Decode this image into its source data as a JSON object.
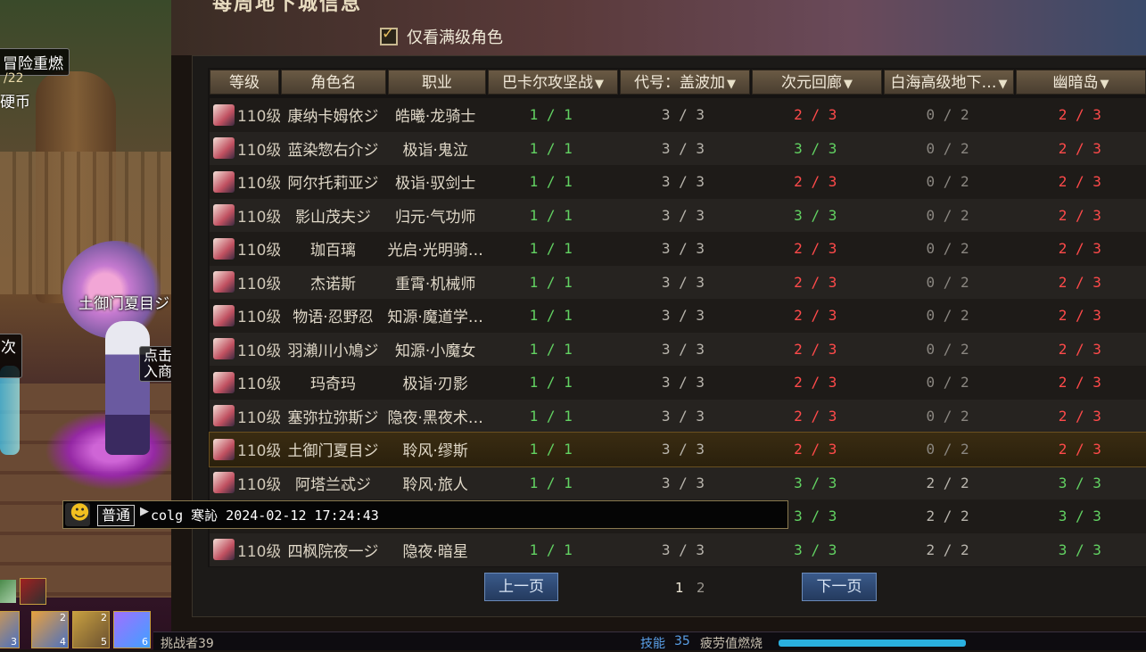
{
  "title": "每周地下城信息",
  "filter": {
    "label": "仅看满级角色",
    "checked": true
  },
  "columns": [
    {
      "label": "等级",
      "dropdown": false
    },
    {
      "label": "角色名",
      "dropdown": false
    },
    {
      "label": "职业",
      "dropdown": false
    },
    {
      "label": "巴卡尔攻坚战",
      "dropdown": true
    },
    {
      "label": "代号：盖波加",
      "dropdown": true
    },
    {
      "label": "次元回廊",
      "dropdown": true
    },
    {
      "label": "白海高级地下…",
      "dropdown": true
    },
    {
      "label": "幽暗岛",
      "dropdown": true
    }
  ],
  "rows": [
    {
      "level": "110级",
      "name": "康纳卡姆依ジ",
      "job": "皓曦·龙骑士",
      "s1": "1 / 1",
      "s2": "3 / 3",
      "s3": "2 / 3",
      "s4": "0 / 2",
      "s5": "2 / 3"
    },
    {
      "level": "110级",
      "name": "蓝染惣右介ジ",
      "job": "极诣·鬼泣",
      "s1": "1 / 1",
      "s2": "3 / 3",
      "s3": "3 / 3",
      "s4": "0 / 2",
      "s5": "2 / 3"
    },
    {
      "level": "110级",
      "name": "阿尔托莉亚ジ",
      "job": "极诣·驭剑士",
      "s1": "1 / 1",
      "s2": "3 / 3",
      "s3": "2 / 3",
      "s4": "0 / 2",
      "s5": "2 / 3"
    },
    {
      "level": "110级",
      "name": "影山茂夫ジ",
      "job": "归元·气功师",
      "s1": "1 / 1",
      "s2": "3 / 3",
      "s3": "3 / 3",
      "s4": "0 / 2",
      "s5": "2 / 3"
    },
    {
      "level": "110级",
      "name": "珈百璃",
      "job": "光启·光明骑…",
      "s1": "1 / 1",
      "s2": "3 / 3",
      "s3": "2 / 3",
      "s4": "0 / 2",
      "s5": "2 / 3"
    },
    {
      "level": "110级",
      "name": "杰诺斯",
      "job": "重霄·机械师",
      "s1": "1 / 1",
      "s2": "3 / 3",
      "s3": "2 / 3",
      "s4": "0 / 2",
      "s5": "2 / 3"
    },
    {
      "level": "110级",
      "name": "物语·忍野忍",
      "job": "知源·魔道学…",
      "s1": "1 / 1",
      "s2": "3 / 3",
      "s3": "2 / 3",
      "s4": "0 / 2",
      "s5": "2 / 3"
    },
    {
      "level": "110级",
      "name": "羽瀨川小鳩ジ",
      "job": "知源·小魔女",
      "s1": "1 / 1",
      "s2": "3 / 3",
      "s3": "2 / 3",
      "s4": "0 / 2",
      "s5": "2 / 3"
    },
    {
      "level": "110级",
      "name": "玛奇玛",
      "job": "极诣·刃影",
      "s1": "1 / 1",
      "s2": "3 / 3",
      "s3": "2 / 3",
      "s4": "0 / 2",
      "s5": "2 / 3"
    },
    {
      "level": "110级",
      "name": "塞弥拉弥斯ジ",
      "job": "隐夜·黑夜术…",
      "s1": "1 / 1",
      "s2": "3 / 3",
      "s3": "2 / 3",
      "s4": "0 / 2",
      "s5": "2 / 3"
    },
    {
      "level": "110级",
      "name": "土御门夏目ジ",
      "job": "聆风·缪斯",
      "s1": "1 / 1",
      "s2": "3 / 3",
      "s3": "2 / 3",
      "s4": "0 / 2",
      "s5": "2 / 3"
    },
    {
      "level": "110级",
      "name": "阿塔兰忒ジ",
      "job": "聆风·旅人",
      "s1": "1 / 1",
      "s2": "3 / 3",
      "s3": "3 / 3",
      "s4": "2 / 2",
      "s5": "3 / 3"
    },
    {
      "level": "",
      "name": "",
      "job": "",
      "s1": "",
      "s2": "",
      "s3": "3 / 3",
      "s4": "2 / 2",
      "s5": "3 / 3"
    },
    {
      "level": "110级",
      "name": "四枫院夜一ジ",
      "job": "隐夜·暗星",
      "s1": "1 / 1",
      "s2": "3 / 3",
      "s3": "3 / 3",
      "s4": "2 / 2",
      "s5": "3 / 3"
    }
  ],
  "colors": {
    "green": "#62d262",
    "white": "#b8b4ac",
    "red": "#ff4a4a",
    "dim": "#8a8680"
  },
  "chat": {
    "channel": "普通",
    "message": "colg 寒訫 2024-02-12 17:24:43"
  },
  "pager": {
    "prev": "上一页",
    "next": "下一页",
    "pages": [
      "1",
      "2"
    ],
    "current": "1"
  },
  "scene": {
    "adventure_label": "冒险重燃",
    "progress_text": "/22",
    "coin_label": "硬币",
    "count_label": "次",
    "player_name": "土御门夏目ジ",
    "npc_hint_1": "点击",
    "npc_hint_2": "入商",
    "slots": [
      {
        "a": "",
        "b": "3"
      },
      {
        "a": "2",
        "b": "4"
      },
      {
        "a": "2",
        "b": "5"
      },
      {
        "a": "",
        "b": "6"
      }
    ]
  },
  "bottom": {
    "challenger": "挑战者39",
    "skill_label": "技能",
    "skill_value": "35",
    "fatigue_label": "疲劳值燃烧"
  }
}
